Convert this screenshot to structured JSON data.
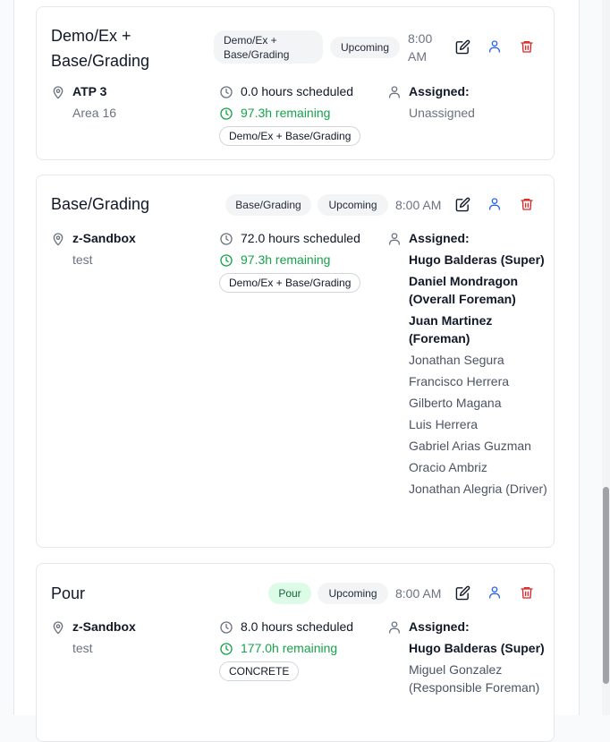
{
  "cards": [
    {
      "title": "Demo/Ex + Base/Grading",
      "category_badge": "Demo/Ex + Base/Grading",
      "status": "Upcoming",
      "time": "8:00 AM",
      "site": "ATP 3",
      "area": "Area 16",
      "hours_scheduled": "0.0 hours scheduled",
      "remaining": "97.3h remaining",
      "tag": "Demo/Ex + Base/Grading",
      "assigned_label": "Assigned:",
      "assignees": [
        {
          "name": "Unassigned",
          "lead": false
        }
      ]
    },
    {
      "title": "Base/Grading",
      "category_badge": "Base/Grading",
      "status": "Upcoming",
      "time": "8:00 AM",
      "site": "z-Sandbox",
      "area": "test",
      "hours_scheduled": "72.0 hours scheduled",
      "remaining": "97.3h remaining",
      "tag": "Demo/Ex + Base/Grading",
      "assigned_label": "Assigned:",
      "assignees": [
        {
          "name": "Hugo Balderas (Super)",
          "lead": true
        },
        {
          "name": "Daniel Mondragon (Overall Foreman)",
          "lead": true
        },
        {
          "name": "Juan Martinez (Foreman)",
          "lead": true
        },
        {
          "name": "Jonathan Segura",
          "lead": false
        },
        {
          "name": "Francisco Herrera",
          "lead": false
        },
        {
          "name": "Gilberto Magana",
          "lead": false
        },
        {
          "name": "Luis Herrera",
          "lead": false
        },
        {
          "name": "Gabriel Arias Guzman",
          "lead": false
        },
        {
          "name": "Oracio Ambriz",
          "lead": false
        },
        {
          "name": "Jonathan Alegria (Driver)",
          "lead": false
        }
      ]
    },
    {
      "title": "Pour",
      "category_badge": "Pour",
      "status": "Upcoming",
      "time": "8:00 AM",
      "site": "z-Sandbox",
      "area": "test",
      "hours_scheduled": "8.0 hours scheduled",
      "remaining": "177.0h remaining",
      "tag": "CONCRETE",
      "assigned_label": "Assigned:",
      "assignees": [
        {
          "name": "Hugo Balderas (Super)",
          "lead": true
        },
        {
          "name": "Miguel Gonzalez (Responsible Foreman)",
          "lead": false
        }
      ]
    }
  ],
  "icons": {
    "location": "location-pin-icon",
    "clock": "clock-icon",
    "user": "user-icon",
    "edit": "edit-icon",
    "assign": "assign-user-icon",
    "delete": "trash-icon"
  },
  "colors": {
    "edit": "#111827",
    "assign": "#2563eb",
    "delete": "#dc2626",
    "remaining": "#16a34a",
    "pour_badge_bg": "#dcfce7"
  }
}
